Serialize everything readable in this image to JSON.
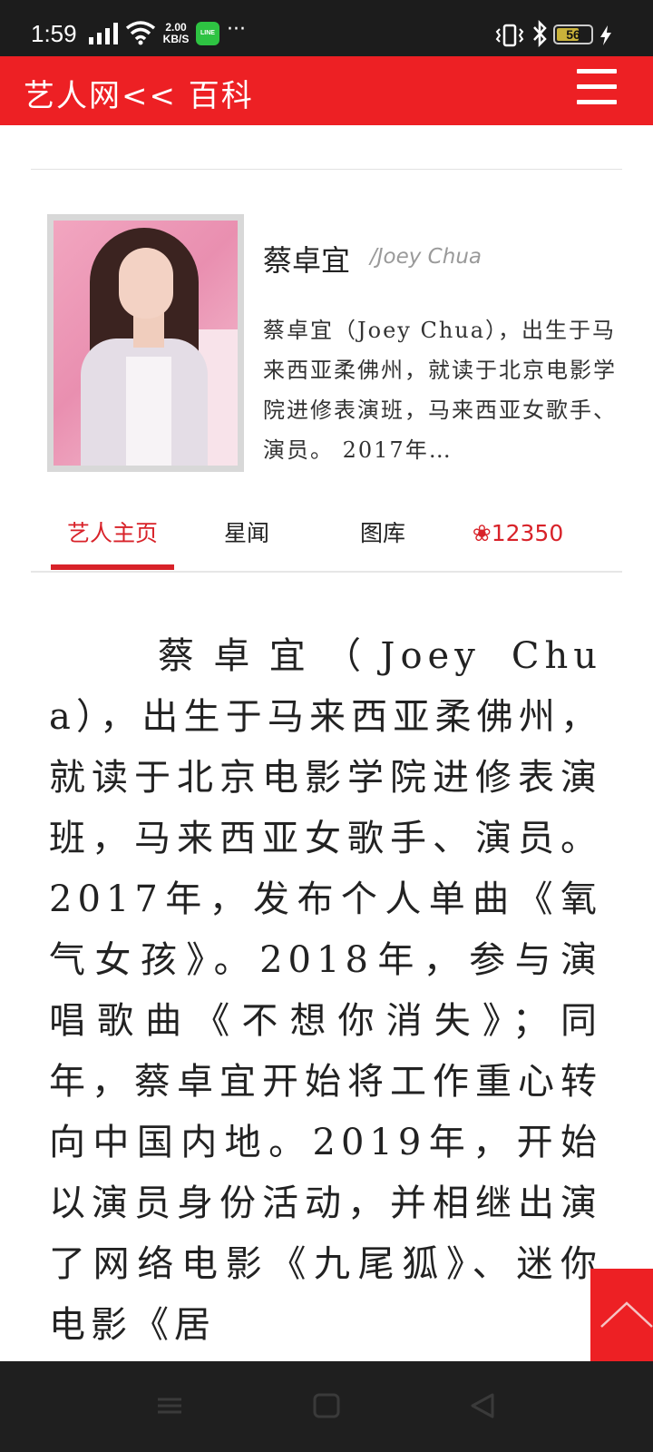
{
  "status_bar": {
    "time": "1:59",
    "net_speed_value": "2.00",
    "net_speed_unit": "KB/S",
    "line_app_label": "LINE",
    "more_dots": "···",
    "battery_level": "56",
    "icons": [
      "signal-icon",
      "wifi-icon",
      "line-app-icon",
      "vibrate-icon",
      "bluetooth-icon",
      "battery-icon",
      "charging-icon"
    ]
  },
  "header": {
    "brand": "艺人网<< 百科",
    "menu_icon": "hamburger-menu-icon",
    "background_color": "#ed2024"
  },
  "profile": {
    "name": "蔡卓宜",
    "english_name": "/Joey Chua",
    "summary": "蔡卓宜（Joey Chua），出生于马来西亚柔佛州，就读于北京电影学院进修表演班，马来西亚女歌手、演员。 2017年…"
  },
  "tabs": [
    {
      "label": "艺人主页",
      "active": true
    },
    {
      "label": "星闻",
      "active": false
    },
    {
      "label": "图库",
      "active": false
    },
    {
      "label": "❀12350",
      "icon": "flower-icon",
      "count": "12350",
      "active": false
    }
  ],
  "article": {
    "text": "蔡卓宜（Joey Chua），出生于马来西亚柔佛州，就读于北京电影学院进修表演班，马来西亚女歌手、演员。 2017年，发布个人单曲《氧气女孩》。2018年，参与演唱歌曲《不想你消失》；同年，蔡卓宜开始将工作重心转向中国内地。2019年，开始以演员身份活动，并相继出演了网络电影《九尾狐》、迷你电影《居"
  },
  "back_to_top": {
    "icon": "chevron-up-icon",
    "color": "#ed2024"
  },
  "nav_bar": {
    "buttons": [
      "recents-menu-icon",
      "home-square-icon",
      "back-triangle-icon"
    ]
  },
  "colors": {
    "accent": "#d82229",
    "header": "#ed2024",
    "status_bar": "#1c1c1c"
  }
}
